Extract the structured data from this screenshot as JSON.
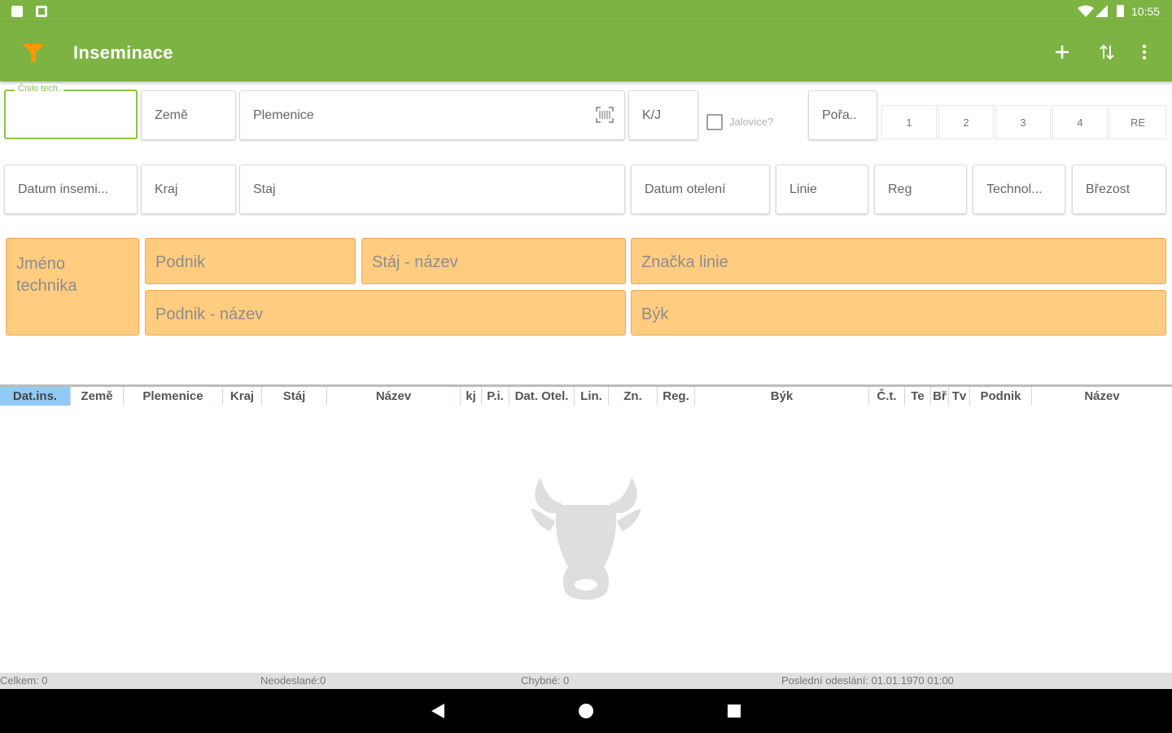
{
  "status": {
    "time": "10:55"
  },
  "appbar": {
    "title": "Inseminace",
    "icons": [
      "filter-icon",
      "add-icon",
      "sort-icon",
      "overflow-menu-icon"
    ]
  },
  "form": {
    "row1": {
      "cislo_tech_label": "Číslo tech.",
      "zeme": "Země",
      "plemenice": "Plemenice",
      "kj": "K/J",
      "jalovice": "Jalovice?",
      "poradi": "Pořa..",
      "nums": [
        "1",
        "2",
        "3",
        "4",
        "RE"
      ]
    },
    "row2": {
      "datum_insem": "Datum insemi...",
      "kraj": "Kraj",
      "staj": "Staj",
      "datum_oteleni": "Datum otelení",
      "linie": "Linie",
      "reg": "Reg",
      "technol": "Technol...",
      "brezost": "Březost"
    }
  },
  "info": {
    "jmeno_technika": "Jméno technika",
    "podnik": "Podnik",
    "staj_nazev": "Stáj - název",
    "znacka_linie": "Značka linie",
    "podnik_nazev": "Podnik - název",
    "byk": "Býk"
  },
  "table": {
    "columns": [
      "Dat.ins.",
      "Země",
      "Plemenice",
      "Kraj",
      "Stáj",
      "Název",
      "kj",
      "P.i.",
      "Dat. Otel.",
      "Lin.",
      "Zn.",
      "Reg.",
      "Býk",
      "Č.t.",
      "Te",
      "Bř",
      "Tv",
      "Podnik",
      "Název"
    ],
    "active_column": "Dat.ins."
  },
  "footer": {
    "celkem": "Celkem: 0",
    "neodeslane": "Neodeslané:0",
    "chybne": "Chybné: 0",
    "posledni": "Poslední odeslání: 01.01.1970 01:00"
  },
  "colors": {
    "appbar": "#7cb342",
    "accent_orange": "#ff9800",
    "block_fill": "#ffcc80",
    "block_border": "#f2a65a",
    "active_header": "#90caf9"
  }
}
